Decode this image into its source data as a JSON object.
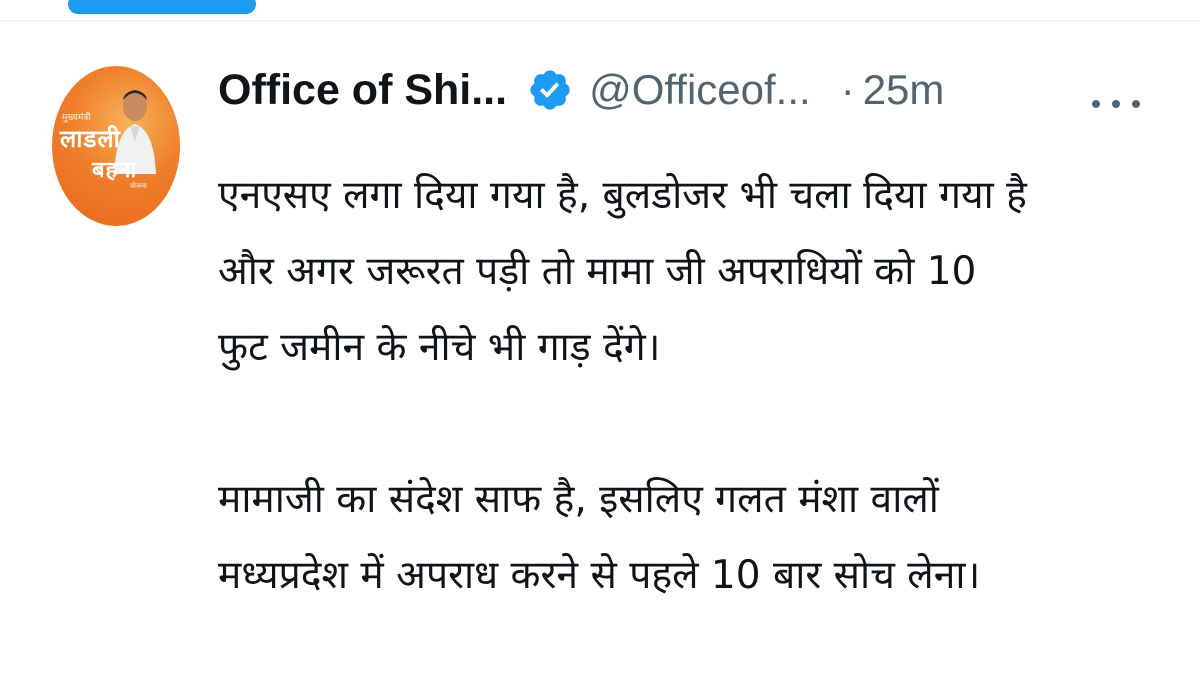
{
  "tweet": {
    "author": {
      "display_name": "Office of Shi...",
      "handle": "@Officeof...",
      "separator": "·",
      "time": "25m",
      "verified": true
    },
    "avatar": {
      "logo_line1": "मुख्यमंत्री",
      "logo_line2": "लाडली",
      "logo_line3": "बहना",
      "logo_line4": "योजना",
      "colors": {
        "primary": "#ef7e2a",
        "light": "#f7b25a"
      }
    },
    "more_icon": "more-horizontal-icon",
    "body": {
      "paragraph1": [
        "एनएसए लगा दिया गया है, बुलडोजर भी चला दिया गया है",
        "और अगर जरूरत पड़ी तो मामा जी अपराधियों को 10",
        "फुट जमीन के नीचे भी गाड़ देंगे।"
      ],
      "paragraph2": [
        "मामाजी का संदेश साफ है, इसलिए गलत मंशा वालों",
        "मध्यप्रदेश में अपराध करने से पहले 10 बार सोच लेना।"
      ]
    }
  },
  "colors": {
    "accent": "#1d9bf0",
    "text": "#0f1419",
    "secondary_text": "#536471",
    "divider": "#eff3f4"
  }
}
